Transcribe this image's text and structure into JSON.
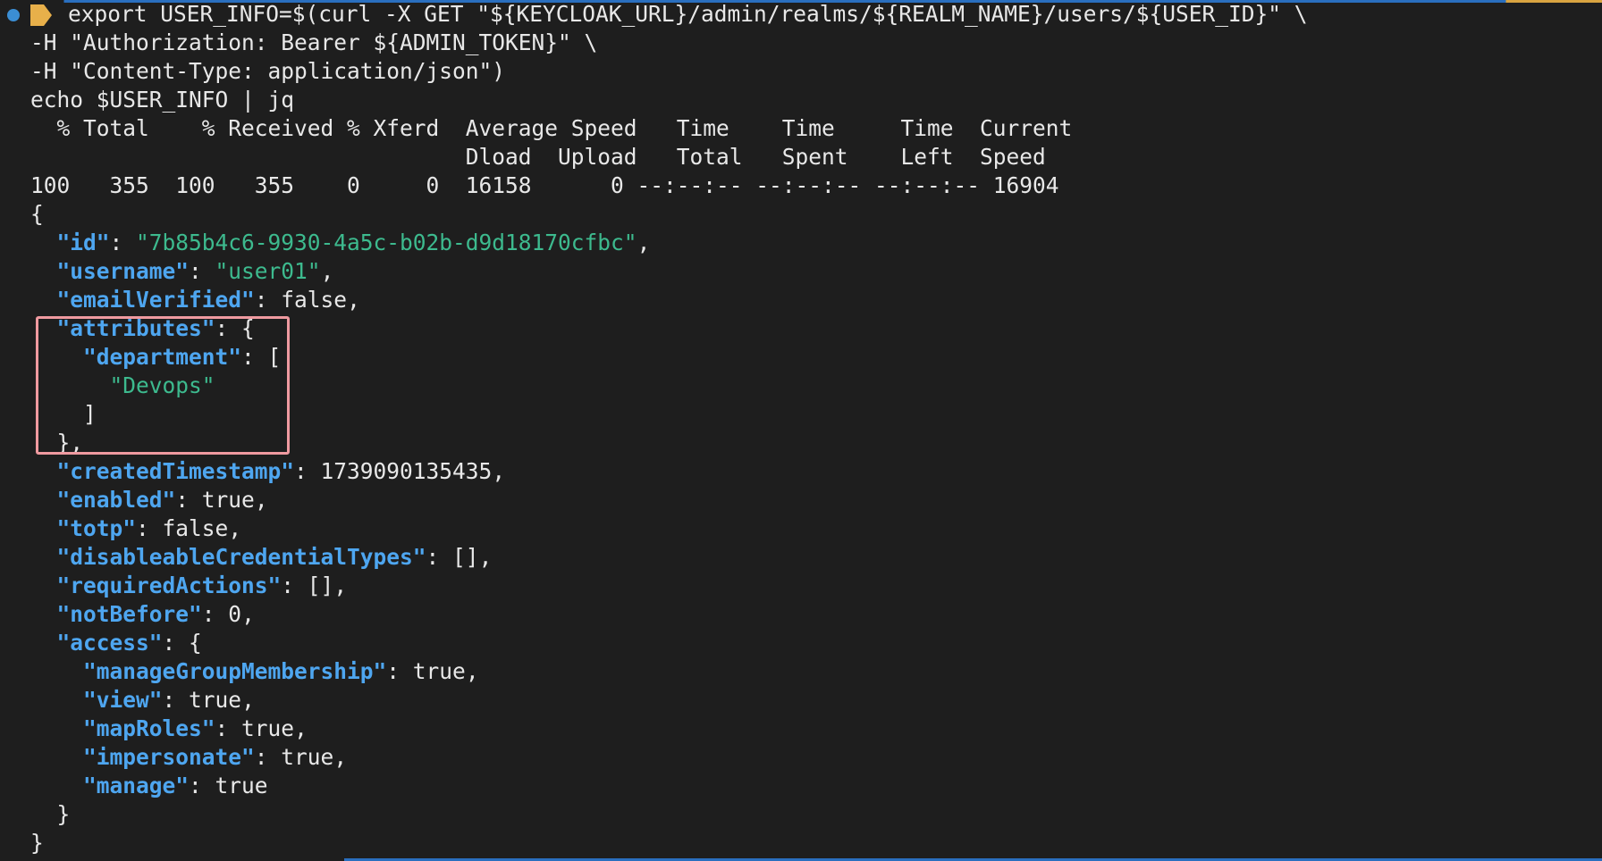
{
  "terminal": {
    "command_lines": [
      "export USER_INFO=$(curl -X GET \"${KEYCLOAK_URL}/admin/realms/${REALM_NAME}/users/${USER_ID}\" \\",
      "-H \"Authorization: Bearer ${ADMIN_TOKEN}\" \\",
      "-H \"Content-Type: application/json\")",
      "echo $USER_INFO | jq"
    ],
    "curl_header_1": "  % Total    % Received % Xferd  Average Speed   Time    Time     Time  Current",
    "curl_header_2": "                                 Dload  Upload   Total   Spent    Left  Speed",
    "curl_progress": "100   355  100   355    0     0  16158      0 --:--:-- --:--:-- --:--:-- 16904",
    "json": {
      "open_brace": "{",
      "close_brace": "}",
      "id_key": "\"id\"",
      "id_val": "\"7b85b4c6-9930-4a5c-b02b-d9d18170cfbc\"",
      "username_key": "\"username\"",
      "username_val": "\"user01\"",
      "emailVerified_key": "\"emailVerified\"",
      "emailVerified_val": "false",
      "attributes_key": "\"attributes\"",
      "department_key": "\"department\"",
      "department_val": "\"Devops\"",
      "createdTimestamp_key": "\"createdTimestamp\"",
      "createdTimestamp_val": "1739090135435",
      "enabled_key": "\"enabled\"",
      "enabled_val": "true",
      "totp_key": "\"totp\"",
      "totp_val": "false",
      "disableableCredentialTypes_key": "\"disableableCredentialTypes\"",
      "disableableCredentialTypes_val": "[]",
      "requiredActions_key": "\"requiredActions\"",
      "requiredActions_val": "[]",
      "notBefore_key": "\"notBefore\"",
      "notBefore_val": "0",
      "access_key": "\"access\"",
      "manageGroupMembership_key": "\"manageGroupMembership\"",
      "manageGroupMembership_val": "true",
      "view_key": "\"view\"",
      "view_val": "true",
      "mapRoles_key": "\"mapRoles\"",
      "mapRoles_val": "true",
      "impersonate_key": "\"impersonate\"",
      "impersonate_val": "true",
      "manage_key": "\"manage\"",
      "manage_val": "true"
    }
  },
  "colors": {
    "background": "#1e1e1e",
    "json_key": "#4ea6f0",
    "json_string": "#3dba8e",
    "highlight_border": "#ef9aa0",
    "prompt_dot": "#3b8ed4",
    "prompt_arrow": "#e8b04a"
  },
  "icons": {
    "prompt_dot": "status-dot-icon",
    "prompt_arrow": "prompt-arrow-icon"
  }
}
